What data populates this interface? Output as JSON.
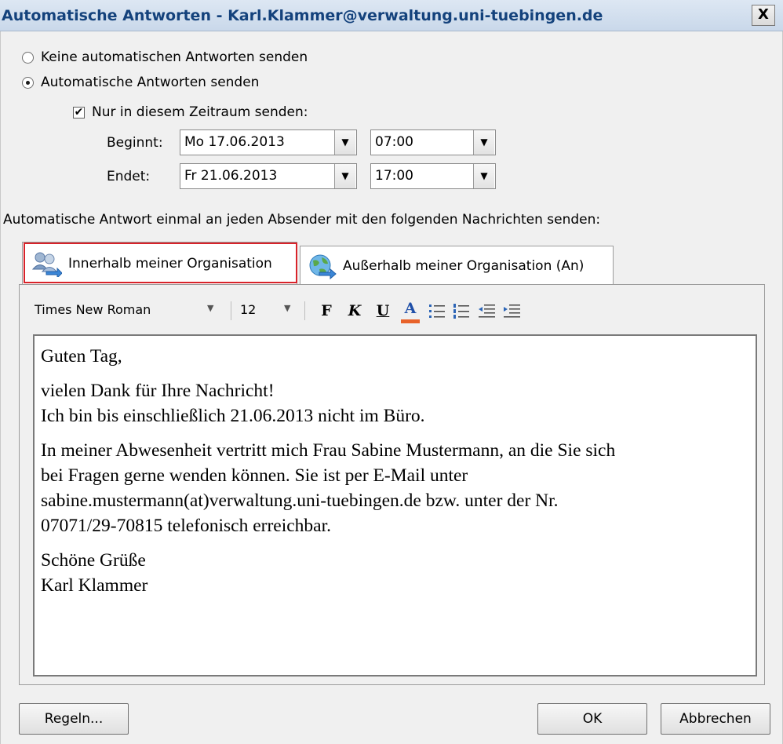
{
  "window": {
    "title": "Automatische Antworten - Karl.Klammer@verwaltung.uni-tuebingen.de",
    "close_label": "X"
  },
  "options": {
    "no_reply_label": "Keine automatischen Antworten senden",
    "no_reply_selected": false,
    "send_reply_label": "Automatische Antworten senden",
    "send_reply_selected": true,
    "only_period_label": "Nur in diesem Zeitraum senden:",
    "only_period_checked": true,
    "checkbox_mark": "✔"
  },
  "schedule": {
    "start_label": "Beginnt:",
    "start_date": "Mo 17.06.2013",
    "start_time": "07:00",
    "end_label": "Endet:",
    "end_date": "Fr 21.06.2013",
    "end_time": "17:00"
  },
  "instruction": "Automatische Antwort einmal an jeden Absender mit den folgenden Nachrichten senden:",
  "tabs": [
    {
      "label": "Innerhalb meiner Organisation",
      "icon": "people-arrow-icon",
      "active": true
    },
    {
      "label": "Außerhalb meiner Organisation (An)",
      "icon": "globe-arrow-icon",
      "active": false
    }
  ],
  "formatting": {
    "font_name": "Times New Roman",
    "font_size": "12",
    "bold": "F",
    "italic": "K",
    "underline": "U",
    "font_color": "A",
    "font_color_hex": "#e8622a"
  },
  "message": {
    "greeting": "Guten Tag,",
    "line1": "vielen Dank für Ihre Nachricht!",
    "line2": "Ich bin bis einschließlich 21.06.2013 nicht im Büro.",
    "para_l1": "In meiner Abwesenheit vertritt mich Frau Sabine Mustermann, an die Sie sich",
    "para_l2": "bei Fragen gerne wenden können. Sie ist per E-Mail unter",
    "para_l3": "sabine.mustermann(at)verwaltung.uni-tuebingen.de bzw. unter der Nr.",
    "para_l4": "07071/29-70815 telefonisch erreichbar.",
    "closing": "Schöne Grüße",
    "signature": "Karl Klammer"
  },
  "buttons": {
    "rules": "Regeln...",
    "ok": "OK",
    "cancel": "Abbrechen"
  },
  "colors": {
    "title_text": "#14427c",
    "active_tab_outline": "#d8232a"
  }
}
